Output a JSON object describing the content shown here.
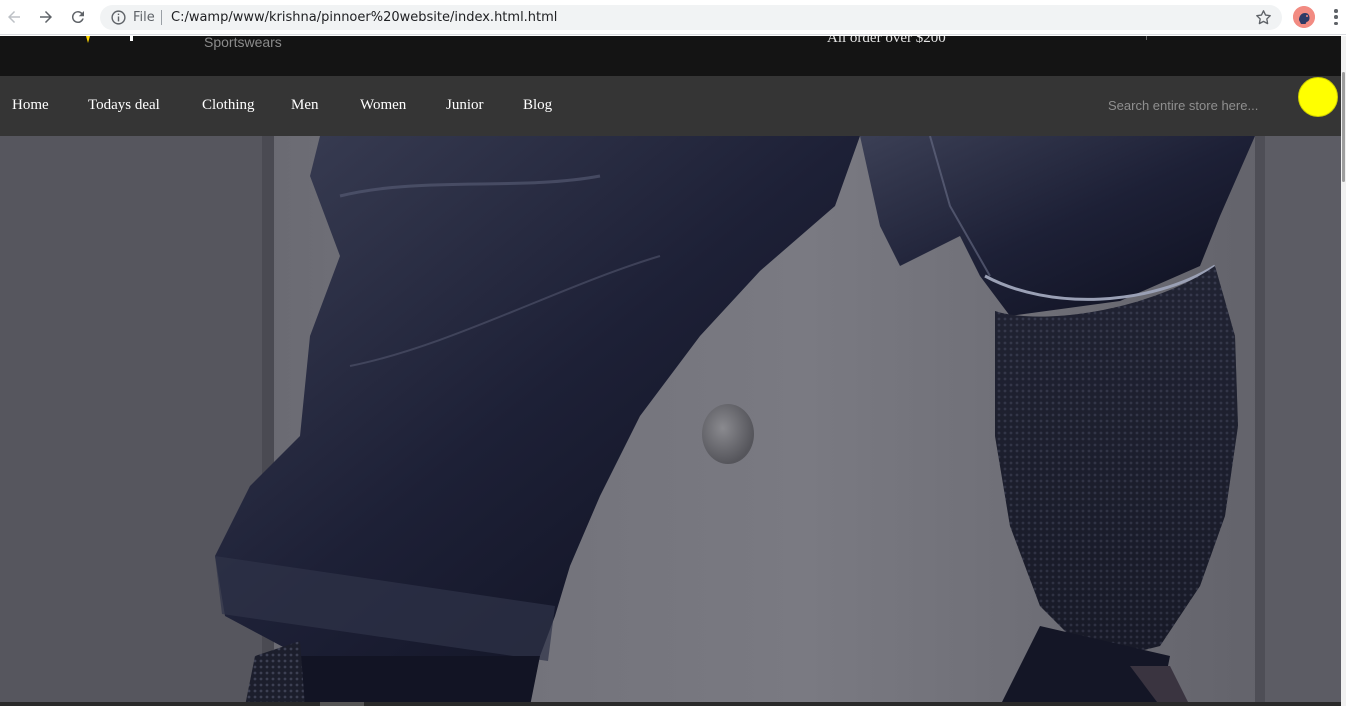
{
  "browser": {
    "scheme_label": "File",
    "url": "C:/wamp/www/krishna/pinnoer%20website/index.html.html",
    "icons": [
      "back-arrow-icon",
      "forward-arrow-icon",
      "reload-icon",
      "info-icon",
      "star-icon",
      "profile-avatar-icon",
      "more-vert-icon"
    ]
  },
  "header": {
    "brand_subtitle": "Sportswears",
    "promo_text": "All order over $200"
  },
  "nav": {
    "items": [
      {
        "label": "Home"
      },
      {
        "label": "Todays deal"
      },
      {
        "label": "Clothing"
      },
      {
        "label": "Men"
      },
      {
        "label": "Women"
      },
      {
        "label": "Junior"
      },
      {
        "label": "Blog"
      }
    ],
    "search_placeholder": "Search entire store here..."
  },
  "colors": {
    "topbar_bg": "#141414",
    "navbar_bg": "#353535",
    "search_button": "#ffff00",
    "logo_accent": "#ffd700"
  }
}
